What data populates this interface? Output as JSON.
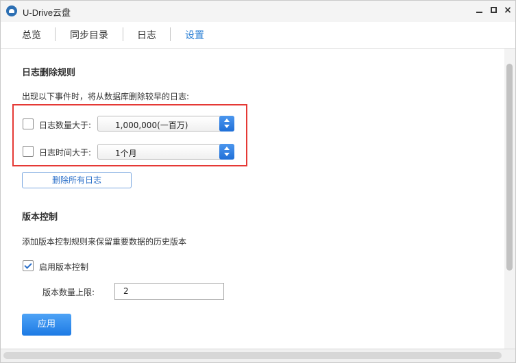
{
  "window": {
    "title": "U-Drive云盘",
    "minimize_label": "—",
    "maximize_label": "",
    "close_label": "×"
  },
  "tabs": [
    {
      "label": "总览",
      "active": false
    },
    {
      "label": "同步目录",
      "active": false
    },
    {
      "label": "日志",
      "active": false
    },
    {
      "label": "设置",
      "active": true
    }
  ],
  "log_rules": {
    "title": "日志删除规则",
    "description": "出现以下事件时，将从数据库删除较早的日志:",
    "count_rule": {
      "checked": false,
      "label": "日志数量大于:",
      "value": "1,000,000(一百万)"
    },
    "time_rule": {
      "checked": false,
      "label": "日志时间大于:",
      "value": "1个月"
    },
    "delete_all_button": "删除所有日志"
  },
  "version_control": {
    "title": "版本控制",
    "description": "添加版本控制规则来保留重要数据的历史版本",
    "enable": {
      "checked": true,
      "label": "启用版本控制"
    },
    "limit_label": "版本数量上限:",
    "limit_value": "2"
  },
  "apply_button": "应用",
  "colors": {
    "accent": "#2a7fd4",
    "highlight_frame": "#e53935",
    "primary_button": "#1d7ae4"
  }
}
